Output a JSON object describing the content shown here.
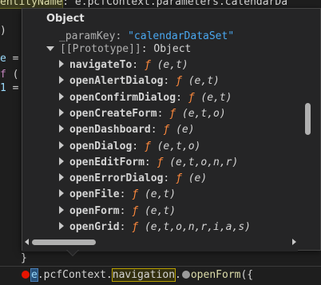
{
  "editor": {
    "top_line": {
      "part1": "entityName",
      "part2": ": e.pcfContext.parameters.calendarDa"
    },
    "left_fragments": {
      "l1": ")",
      "l2a": "e",
      "l2b": " =",
      "l3a": "f",
      "l3b": " (",
      "l4a": "1",
      "l4b": " ="
    },
    "closing_brace": "}",
    "current_line": {
      "e": "e",
      "p1": ".pcfContext.",
      "nav": "navigation",
      "p2": ".",
      "method": "openForm",
      "p3": "({"
    }
  },
  "tooltip": {
    "header": "Object",
    "param_key": {
      "key": "_paramKey",
      "sep": ": ",
      "value": "\"calendarDataSet\""
    },
    "prototype": {
      "label": "[[Prototype]]",
      "value": ": Object"
    },
    "methods": [
      {
        "name": "navigateTo",
        "params": "(e,t)"
      },
      {
        "name": "openAlertDialog",
        "params": "(e,t)"
      },
      {
        "name": "openConfirmDialog",
        "params": "(e,t)"
      },
      {
        "name": "openCreateForm",
        "params": "(e,t,o)"
      },
      {
        "name": "openDashboard",
        "params": "(e)"
      },
      {
        "name": "openDialog",
        "params": "(e,t,o)"
      },
      {
        "name": "openEditForm",
        "params": "(e,t,o,n,r)"
      },
      {
        "name": "openErrorDialog",
        "params": "(e)"
      },
      {
        "name": "openFile",
        "params": "(e,t)"
      },
      {
        "name": "openForm",
        "params": "(e,t)"
      },
      {
        "name": "openGrid",
        "params": "(e,t,o,n,r,i,a,s)"
      }
    ],
    "fn_symbol": "ƒ",
    "colon": ":"
  },
  "colors": {
    "background": "#1e1e1e",
    "tooltip_bg": "#252526",
    "string": "#4aa8f0",
    "function_symbol": "#ff8a3d",
    "breakpoint": "#e51400"
  }
}
